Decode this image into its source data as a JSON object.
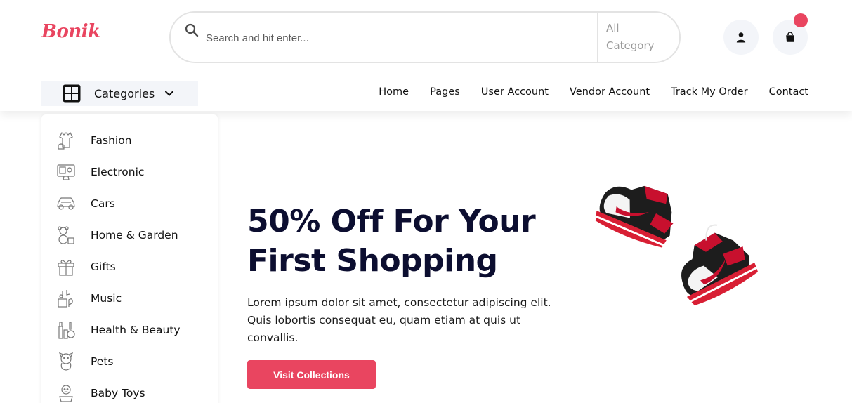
{
  "header": {
    "logo": "Bonik",
    "search": {
      "placeholder": "Search and hit enter...",
      "value": "",
      "category": "All Category"
    },
    "user_icon": "user-icon",
    "cart_icon": "shopping-bag-icon",
    "accent": "#e94560"
  },
  "nav": {
    "categories_label": "Categories",
    "links": [
      "Home",
      "Pages",
      "User Account",
      "Vendor Account",
      "Track My Order",
      "Contact"
    ]
  },
  "sidebar": {
    "items": [
      {
        "label": "Fashion",
        "icon": "dress-icon"
      },
      {
        "label": "Electronic",
        "icon": "monitor-icon"
      },
      {
        "label": "Cars",
        "icon": "car-icon"
      },
      {
        "label": "Home & Garden",
        "icon": "teddy-bear-icon"
      },
      {
        "label": "Gifts",
        "icon": "gift-icon"
      },
      {
        "label": "Music",
        "icon": "music-icon"
      },
      {
        "label": "Health & Beauty",
        "icon": "cosmetics-icon"
      },
      {
        "label": "Pets",
        "icon": "pet-icon"
      },
      {
        "label": "Baby Toys",
        "icon": "baby-icon"
      }
    ]
  },
  "hero": {
    "title_line1": "50% Off For Your",
    "title_line2": "First Shopping",
    "text": "Lorem ipsum dolor sit amet, consectetur adipiscing elit. Quis lobortis consequat eu, quam etiam at quis ut convallis.",
    "cta": "Visit Collections",
    "image": "sneakers-image"
  }
}
